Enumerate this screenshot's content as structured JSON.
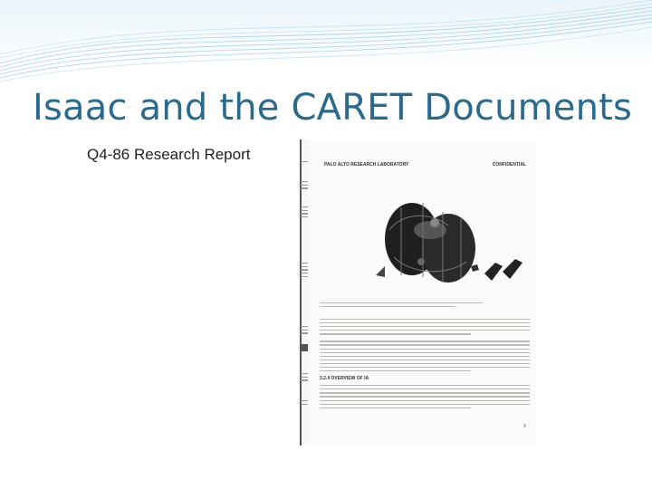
{
  "slide": {
    "title": "Isaac and the CARET Documents",
    "bullet": "Q4-86 Research Report"
  },
  "scan": {
    "header_left": "PALO ALTO RESEARCH LABORATORY",
    "header_right": "CONFIDENTIAL",
    "section_heading": "3.2.4 OVERVIEW OF IA",
    "page_number": "6"
  },
  "colors": {
    "title": "#2b6a8d",
    "accent_waves": "#7fb8d8",
    "background_top": "#e9f4fa"
  }
}
